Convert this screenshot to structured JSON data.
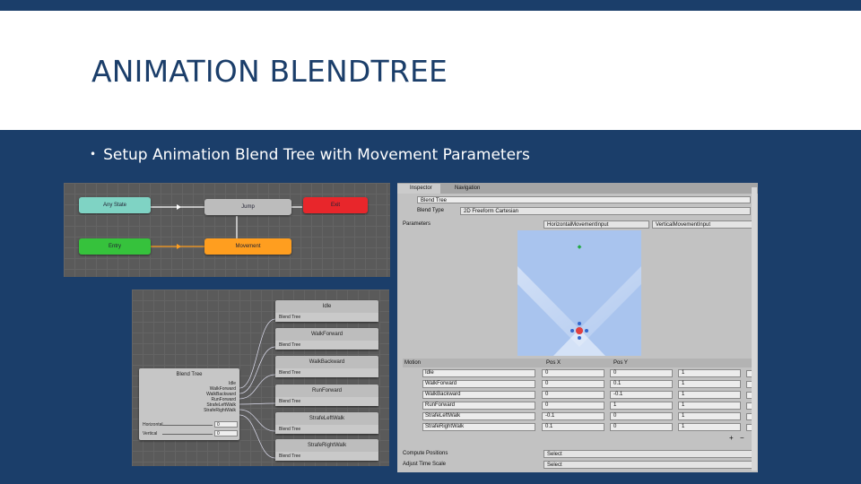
{
  "slide": {
    "title": "ANIMATION BLENDTREE",
    "bullet": "Setup Animation Blend Tree with Movement Parameters"
  },
  "animator": {
    "states": [
      "Any State",
      "Jump",
      "Exit",
      "Entry",
      "Movement"
    ],
    "colors": {
      "any": "#7fd3c4",
      "default": "#bcbcbc",
      "exit": "#e8262b",
      "entry": "#36c23c",
      "movement": "#ff9e1f"
    }
  },
  "blendtree_graph": {
    "children": [
      {
        "title": "Idle",
        "sub": "Blend Tree"
      },
      {
        "title": "WalkForward",
        "sub": "Blend Tree"
      },
      {
        "title": "WalkBackward",
        "sub": "Blend Tree"
      },
      {
        "title": "RunForward",
        "sub": "Blend Tree"
      },
      {
        "title": "StrafeLeftWalk",
        "sub": "Blend Tree"
      },
      {
        "title": "StrafeRightWalk",
        "sub": "Blend Tree"
      }
    ],
    "root_title": "Blend Tree",
    "root_outputs": [
      "Idle",
      "WalkForward",
      "WalkBackward",
      "RunForward",
      "StrafeLeftWalk",
      "StrafeRightWalk"
    ],
    "params": [
      {
        "name": "Horizontal",
        "value": "0"
      },
      {
        "name": "Vertical",
        "value": "0"
      }
    ]
  },
  "inspector": {
    "tabs": [
      "Inspector",
      "Navigation"
    ],
    "name_value": "Blend Tree",
    "blend_type_label": "Blend Type",
    "blend_type_value": "2D Freeform Cartesian",
    "parameters_label": "Parameters",
    "param_x": "HorizontalMovementInput",
    "param_y": "VerticalMovementInput",
    "motion_headers": [
      "Motion",
      "Pos X",
      "Pos Y"
    ],
    "motions": [
      {
        "name": "Idle",
        "x": "0",
        "y": "0",
        "speed": "1"
      },
      {
        "name": "WalkForward",
        "x": "0",
        "y": "0.1",
        "speed": "1"
      },
      {
        "name": "WalkBackward",
        "x": "0",
        "y": "-0.1",
        "speed": "1"
      },
      {
        "name": "RunForward",
        "x": "0",
        "y": "1",
        "speed": "1"
      },
      {
        "name": "StrafeLeftWalk",
        "x": "-0.1",
        "y": "0",
        "speed": "1"
      },
      {
        "name": "StrafeRightWalk",
        "x": "0.1",
        "y": "0",
        "speed": "1"
      }
    ],
    "compute_positions_label": "Compute Positions",
    "compute_positions_value": "Select",
    "adjust_time_scale_label": "Adjust Time Scale",
    "adjust_time_scale_value": "Select"
  }
}
